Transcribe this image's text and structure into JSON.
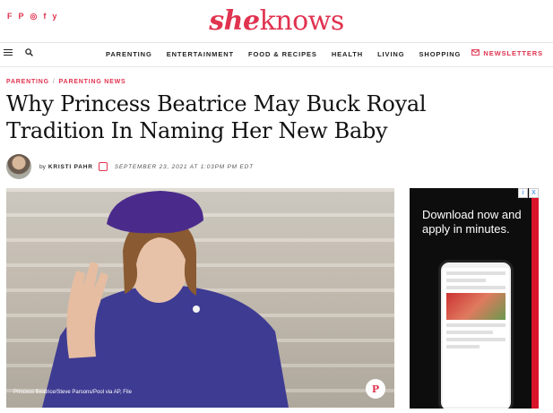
{
  "social": {
    "items": [
      "F",
      "P",
      "◎",
      "f",
      "y"
    ]
  },
  "brand": {
    "logo_she": "she",
    "logo_knows": "knows",
    "accent_color": "#e0334f"
  },
  "nav": {
    "items": [
      "PARENTING",
      "ENTERTAINMENT",
      "FOOD & RECIPES",
      "HEALTH",
      "LIVING",
      "SHOPPING"
    ],
    "newsletters_label": "NEWSLETTERS"
  },
  "breadcrumb": {
    "items": [
      "PARENTING",
      "PARENTING NEWS"
    ],
    "separator": "/"
  },
  "article": {
    "headline": "Why Princess Beatrice May Buck Royal Tradition In Naming Her New Baby",
    "byline_prefix": "by",
    "author": "KRISTI PAHR",
    "date": "SEPTEMBER 23, 2021 AT 1:03PM PM EDT",
    "image_caption": "Princess Beatrice/Steve Parsons/Pool via AP, File",
    "pin_label": "P"
  },
  "ad": {
    "close_labels": [
      "i",
      "X"
    ],
    "headline": "Download now and apply in minutes."
  }
}
